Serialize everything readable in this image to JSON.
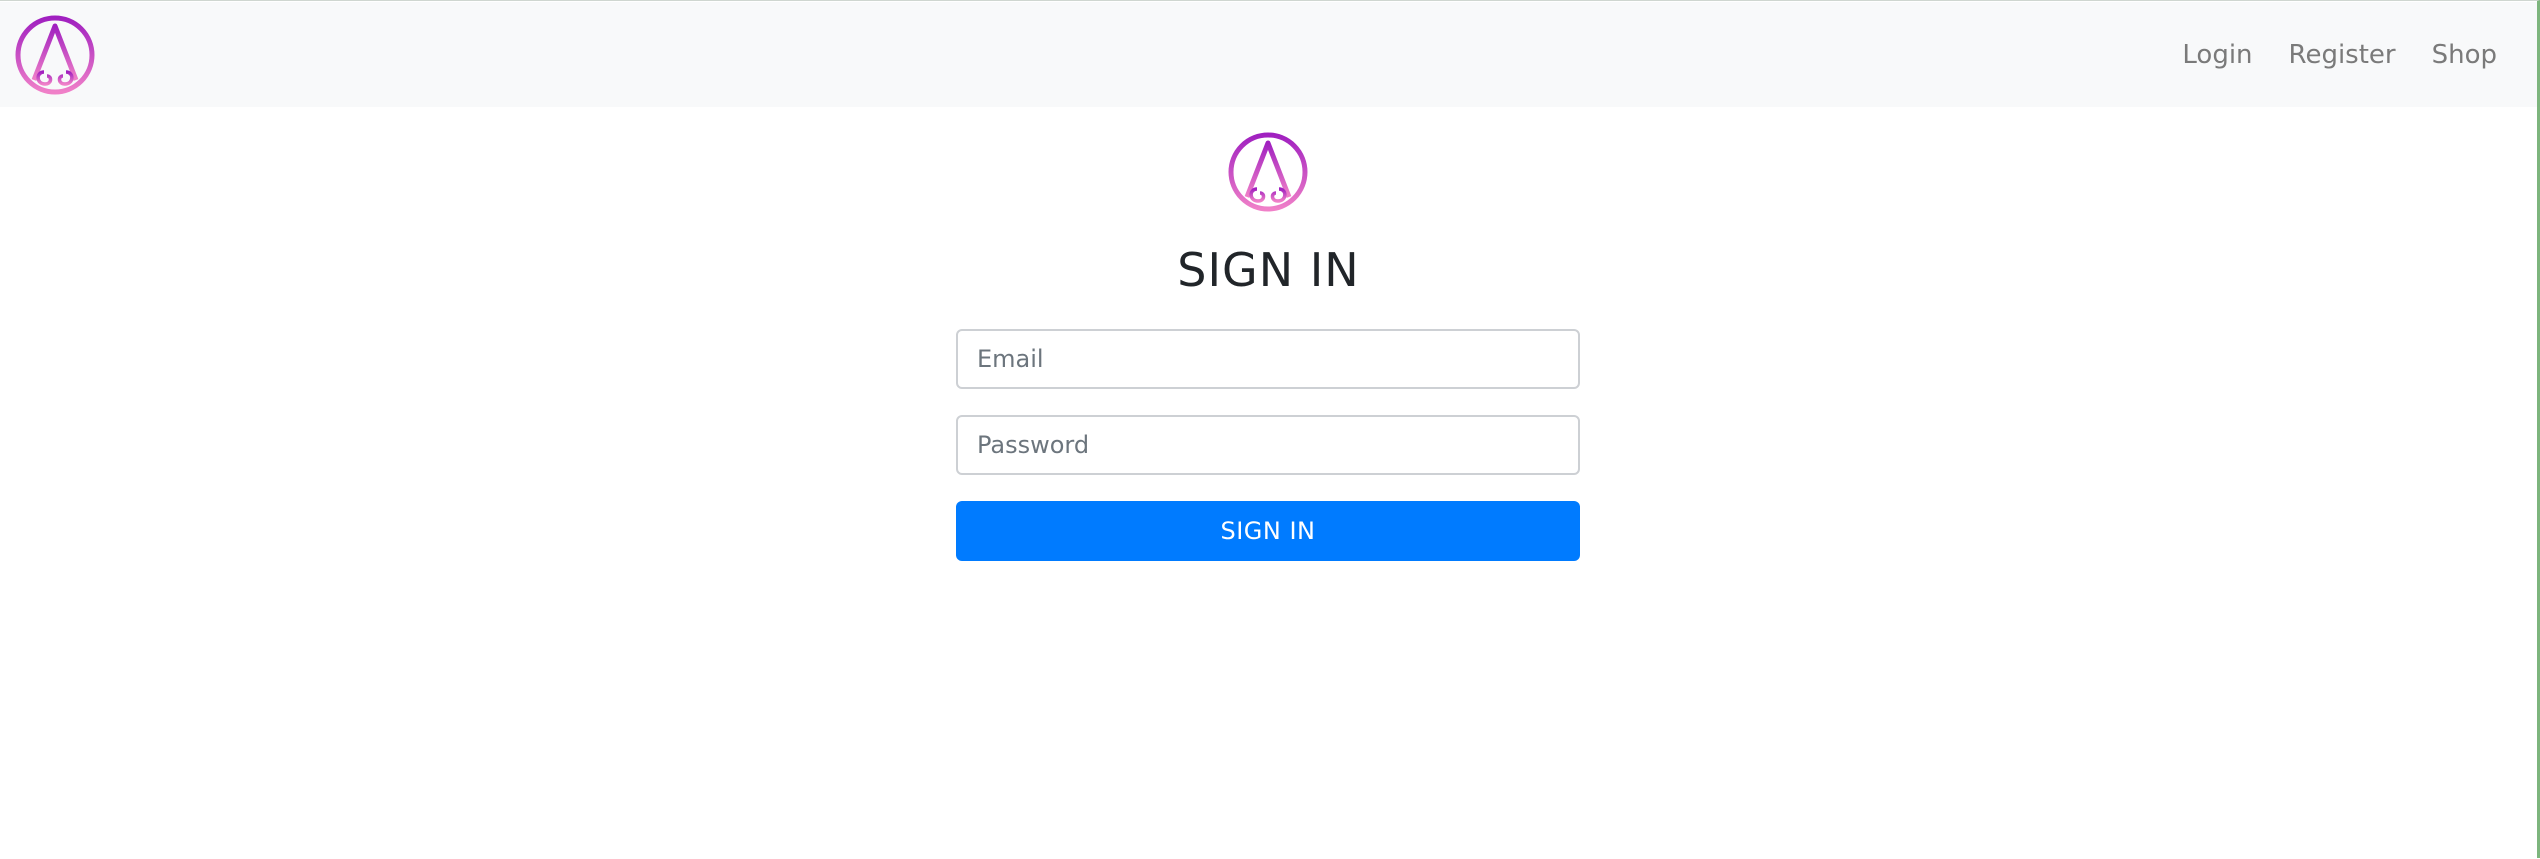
{
  "nav": {
    "brand_icon": "brand-logo-a-icon",
    "links": [
      "Login",
      "Register",
      "Shop"
    ]
  },
  "signin": {
    "logo_icon": "brand-logo-a-icon",
    "title": "SIGN IN",
    "email_placeholder": "Email",
    "email_value": "",
    "password_placeholder": "Password",
    "password_value": "",
    "submit_label": "SIGN IN"
  },
  "colors": {
    "primary": "#007bff",
    "navbar_bg": "#f8f9fa",
    "logo_gradient_top": "#a020c0",
    "logo_gradient_bottom": "#f080c8",
    "nav_link": "#7a7a7a",
    "title": "#212529"
  }
}
